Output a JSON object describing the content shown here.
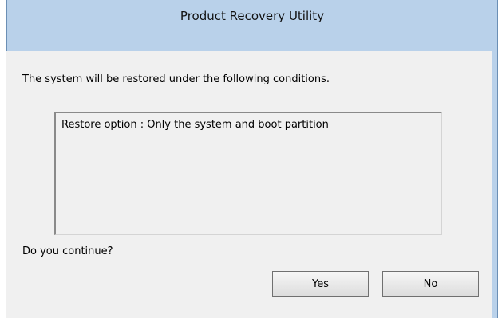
{
  "window": {
    "title": "Product Recovery Utility"
  },
  "dialog": {
    "message": "The system will be restored under the following conditions.",
    "restore_option": "Restore option : Only the system and boot partition",
    "question": "Do you continue?",
    "yes_label": "Yes",
    "no_label": "No"
  },
  "colors": {
    "frame": "#b9d1ea",
    "client": "#f0f0f0"
  }
}
